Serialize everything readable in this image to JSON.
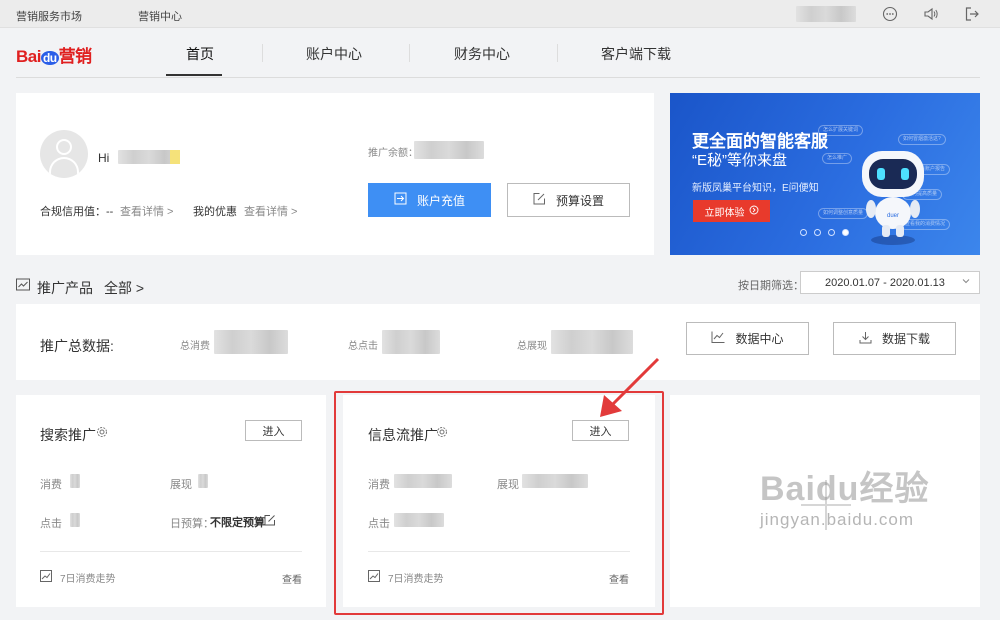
{
  "topbar": {
    "market_label": "营销服务市场",
    "center_label": "营销中心"
  },
  "nav": {
    "logo_bai": "Bai",
    "logo_du": "du",
    "logo_suffix": "营销",
    "tabs": [
      "首页",
      "账户中心",
      "财务中心",
      "客户端下载"
    ]
  },
  "profile": {
    "greeting": "Hi",
    "credit_label": "合规信用值：--",
    "credit_link": "查看详情 >",
    "discount_label": "我的优惠",
    "discount_link": "查看详情 >",
    "balance_label": "推广余额：",
    "recharge_label": "账户充值",
    "budget_label": "预算设置"
  },
  "banner": {
    "title": "更全面的智能客服",
    "subtitle": "“E秘”等你来盘",
    "desc": "新版凤巢平台知识，E问便知",
    "cta": "立即体验",
    "bubbles": [
      "怎么扩展关键词",
      "如何冒烟激活这?",
      "怎么推广",
      "查看账户报告",
      "如何提高质量",
      "怎么优化的创意",
      "查看我的余额"
    ],
    "bubbles_bottom": [
      "如何调整创意质量",
      "查看我的消费情况"
    ],
    "robot_badge": "duer",
    "slides": 4,
    "active_slide": 4
  },
  "products": {
    "title": "推广产品",
    "all_link": "全部 >",
    "date_filter_label": "按日期筛选：",
    "date_range": "2020.01.07 - 2020.01.13"
  },
  "summary": {
    "title": "推广总数据:",
    "spend_label": "总消费",
    "clicks_label": "总点击",
    "impressions_label": "总展现",
    "data_center_label": "数据中心",
    "download_label": "数据下载"
  },
  "search_promo": {
    "title": "搜索推广",
    "enter_label": "进入",
    "spend_label": "消费",
    "impr_label": "展现",
    "click_label": "点击",
    "budget_label": "日预算：",
    "budget_value": "不限定预算",
    "trend_label": "7日消费走势",
    "view_label": "查看"
  },
  "feed_promo": {
    "title": "信息流推广",
    "enter_label": "进入",
    "spend_label": "消费",
    "impr_label": "展现",
    "click_label": "点击",
    "trend_label": "7日消费走势",
    "view_label": "查看"
  },
  "watermark": {
    "brand": "Baidu经验",
    "url": "jingyan.baidu.com"
  },
  "colors": {
    "accent_blue": "#3e8ff4",
    "brand_red": "#e02020",
    "highlight_red": "#e23a3a",
    "banner_blue": "#1a55c9"
  }
}
